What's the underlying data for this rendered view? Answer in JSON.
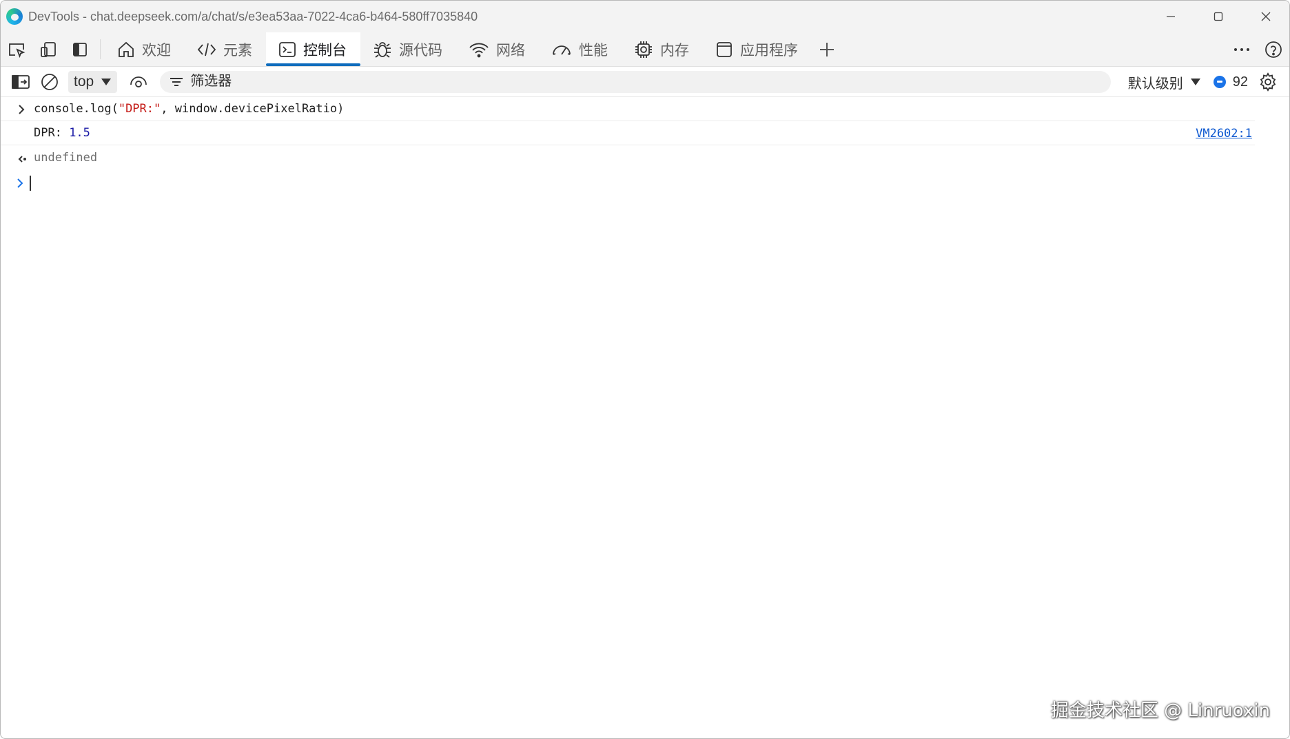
{
  "window": {
    "title": "DevTools - chat.deepseek.com/a/chat/s/e3ea53aa-7022-4ca6-b464-580ff7035840"
  },
  "tabs": [
    {
      "label": "欢迎",
      "icon": "home-icon",
      "active": false
    },
    {
      "label": "元素",
      "icon": "code-icon",
      "active": false
    },
    {
      "label": "控制台",
      "icon": "console-icon",
      "active": true
    },
    {
      "label": "源代码",
      "icon": "bug-icon",
      "active": false
    },
    {
      "label": "网络",
      "icon": "wifi-icon",
      "active": false
    },
    {
      "label": "性能",
      "icon": "gauge-icon",
      "active": false
    },
    {
      "label": "内存",
      "icon": "chip-icon",
      "active": false
    },
    {
      "label": "应用程序",
      "icon": "app-window-icon",
      "active": false
    }
  ],
  "console_toolbar": {
    "context": "top",
    "filter_placeholder": "筛选器",
    "level": "默认级别",
    "message_count": "92"
  },
  "console": {
    "input_prefix": "console.log(",
    "input_string": "\"DPR:\"",
    "input_suffix": ", window.devicePixelRatio)",
    "log_label": "DPR: ",
    "log_value": "1.5",
    "log_source": "VM2602:1",
    "return_value": "undefined"
  },
  "watermark": "掘金技术社区 @ Linruoxin",
  "colors": {
    "accent": "#0f6cbd",
    "string": "#c41a16",
    "number": "#1a1aa6",
    "link": "#0b57d0"
  }
}
